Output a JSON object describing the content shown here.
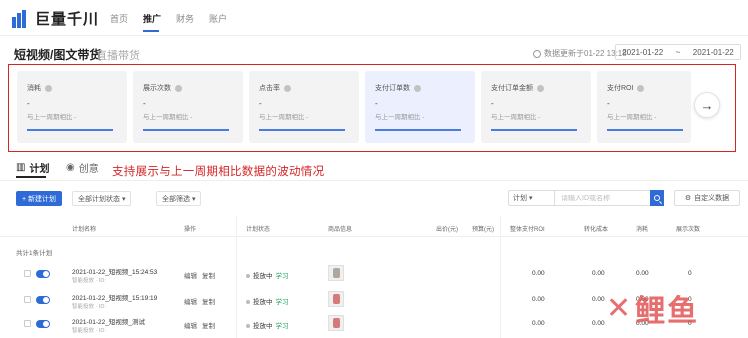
{
  "app": {
    "logo_text": "巨量千川"
  },
  "nav": {
    "items": [
      {
        "label": "首页"
      },
      {
        "label": "推广"
      },
      {
        "label": "财务"
      },
      {
        "label": "账户"
      }
    ]
  },
  "header": {
    "title": "短视频/图文带货",
    "subtab": "直播带货",
    "data_time": "数据更新于01-22 13:18",
    "date_start": "2021-01-22",
    "date_sep": "~",
    "date_end": "2021-01-22"
  },
  "metrics": [
    {
      "label": "消耗",
      "value": "-",
      "compare": "与上一周期相比 -"
    },
    {
      "label": "展示次数",
      "value": "-",
      "compare": "与上一周期相比 -"
    },
    {
      "label": "点击率",
      "value": "-",
      "compare": "与上一周期相比 -"
    },
    {
      "label": "支付订单数",
      "value": "-",
      "compare": "与上一周期相比 -"
    },
    {
      "label": "支付订单金额",
      "value": "-",
      "compare": "与上一周期相比 -"
    },
    {
      "label": "支付ROI",
      "value": "-",
      "compare": "与上一周期相比 -"
    }
  ],
  "tabs": {
    "plan": "计划",
    "creative": "创意"
  },
  "annotation": "支持展示与上一周期相比数据的波动情况",
  "toolbar": {
    "new_plan": "+ 新建计划",
    "filter_status": "全部计划状态 ▾",
    "filter_all": "全部筛选 ▾",
    "search_scope": "计划 ▾",
    "search_placeholder": "请输入ID或名称",
    "custom_data": "自定义数据"
  },
  "table": {
    "headers": [
      "计划名称",
      "操作",
      "计划状态",
      "商品信息",
      "出价(元)",
      "预算(元)",
      "整体支付ROI",
      "转化成本",
      "消耗",
      "展示次数"
    ],
    "total_label": "共计1条计划",
    "rows": [
      {
        "name": "2021-01-22_短视频_15:24:53",
        "sub": "智能投放 · ID:",
        "op_edit": "编辑",
        "op_copy": "复制",
        "status": "投放中",
        "tag": "学习",
        "cost": "0.00",
        "conv": "0.00",
        "roi": "0.00",
        "shows": "0"
      },
      {
        "name": "2021-01-22_短视频_15:19:19",
        "sub": "智能投放 · ID:",
        "op_edit": "编辑",
        "op_copy": "复制",
        "status": "投放中",
        "tag": "学习",
        "cost": "0.00",
        "conv": "0.00",
        "roi": "0.00",
        "shows": "0"
      },
      {
        "name": "2021-01-22_短视频_测试",
        "sub": "智能投放 · ID:",
        "op_edit": "编辑",
        "op_copy": "复制",
        "status": "投放中",
        "tag": "学习",
        "cost": "0.00",
        "conv": "0.00",
        "roi": "0.00",
        "shows": "0"
      }
    ]
  },
  "watermark": {
    "mark": "✕",
    "text": "鲤鱼"
  },
  "colors": {
    "accent": "#2f6bd6",
    "highlight_border": "#d42525",
    "annotation": "#d42525"
  }
}
